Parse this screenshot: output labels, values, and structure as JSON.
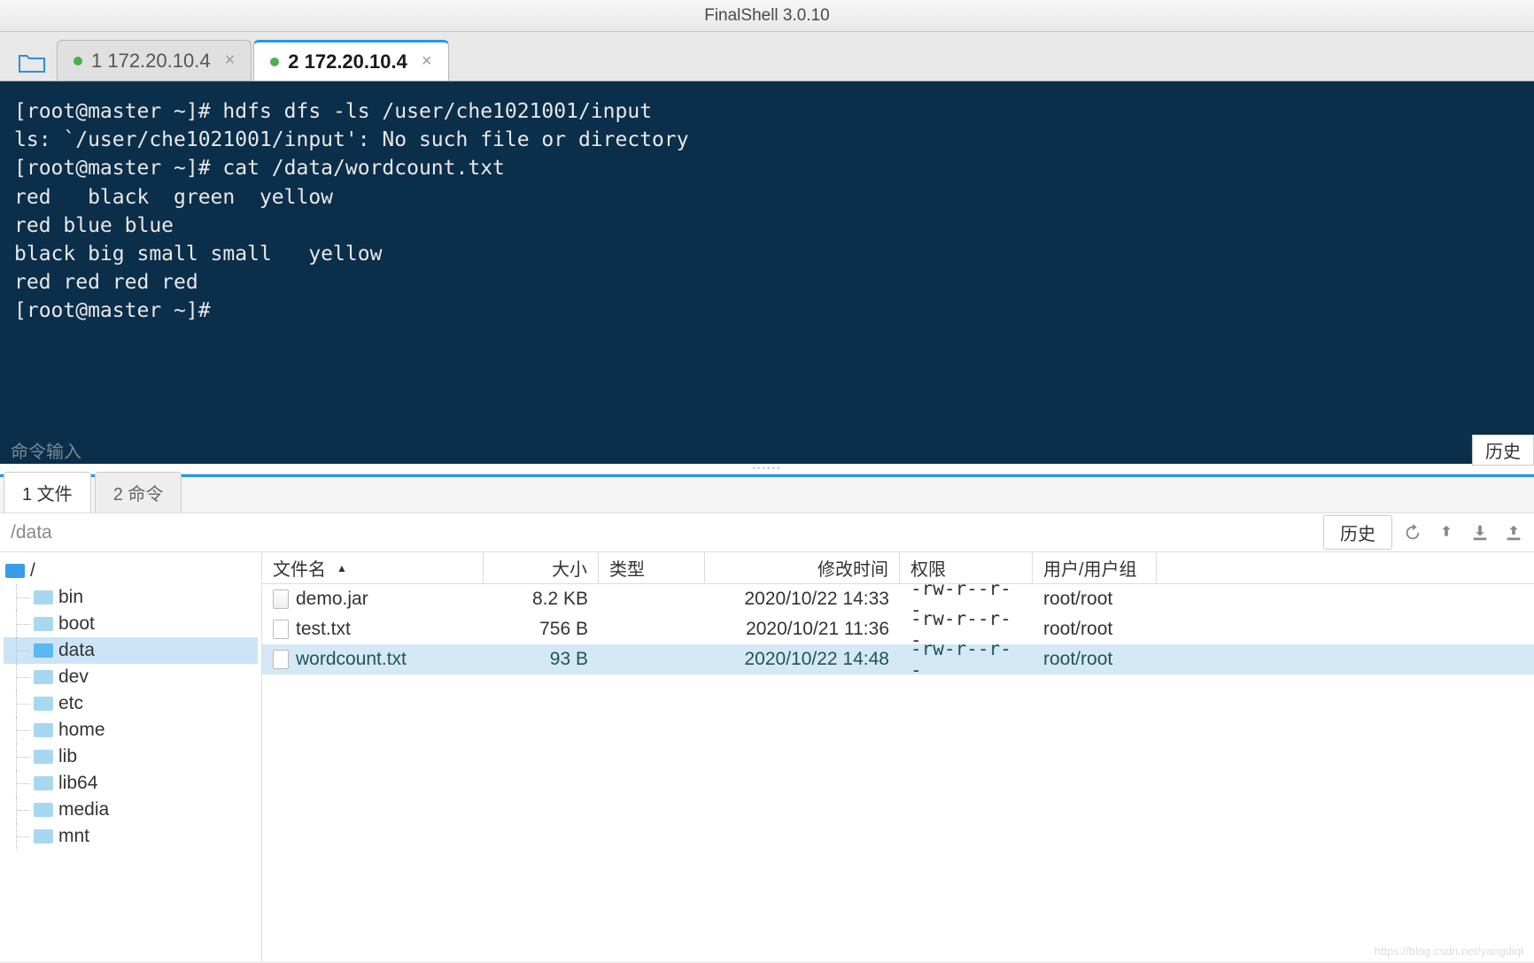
{
  "window": {
    "title": "FinalShell 3.0.10"
  },
  "tabs": [
    {
      "label": "1 172.20.10.4",
      "active": false
    },
    {
      "label": "2 172.20.10.4",
      "active": true
    }
  ],
  "terminal": {
    "lines": "[root@master ~]# hdfs dfs -ls /user/che1021001/input\nls: `/user/che1021001/input': No such file or directory\n[root@master ~]# cat /data/wordcount.txt\nred   black  green  yellow\nred blue blue\nblack big small small   yellow\nred red red red\n[root@master ~]# "
  },
  "cmdbar": {
    "placeholder": "命令输入",
    "history": "历史"
  },
  "bottom_tabs": [
    {
      "label": "1 文件",
      "active": true
    },
    {
      "label": "2 命令",
      "active": false
    }
  ],
  "pathbar": {
    "path": "/data",
    "history": "历史"
  },
  "tree": {
    "root": "/",
    "items": [
      {
        "name": "bin",
        "selected": false
      },
      {
        "name": "boot",
        "selected": false
      },
      {
        "name": "data",
        "selected": true
      },
      {
        "name": "dev",
        "selected": false
      },
      {
        "name": "etc",
        "selected": false
      },
      {
        "name": "home",
        "selected": false
      },
      {
        "name": "lib",
        "selected": false
      },
      {
        "name": "lib64",
        "selected": false
      },
      {
        "name": "media",
        "selected": false
      },
      {
        "name": "mnt",
        "selected": false
      }
    ]
  },
  "filelist": {
    "headers": {
      "name": "文件名",
      "size": "大小",
      "type": "类型",
      "date": "修改时间",
      "perm": "权限",
      "user": "用户/用户组"
    },
    "rows": [
      {
        "name": "demo.jar",
        "icon": "jar",
        "size": "8.2 KB",
        "type": "",
        "date": "2020/10/22 14:33",
        "perm": "-rw-r--r--",
        "user": "root/root",
        "selected": false
      },
      {
        "name": "test.txt",
        "icon": "txt",
        "size": "756 B",
        "type": "",
        "date": "2020/10/21 11:36",
        "perm": "-rw-r--r--",
        "user": "root/root",
        "selected": false
      },
      {
        "name": "wordcount.txt",
        "icon": "txt",
        "size": "93 B",
        "type": "",
        "date": "2020/10/22 14:48",
        "perm": "-rw-r--r--",
        "user": "root/root",
        "selected": true
      }
    ]
  },
  "watermark": "https://blog.csdn.net/yangdiql"
}
